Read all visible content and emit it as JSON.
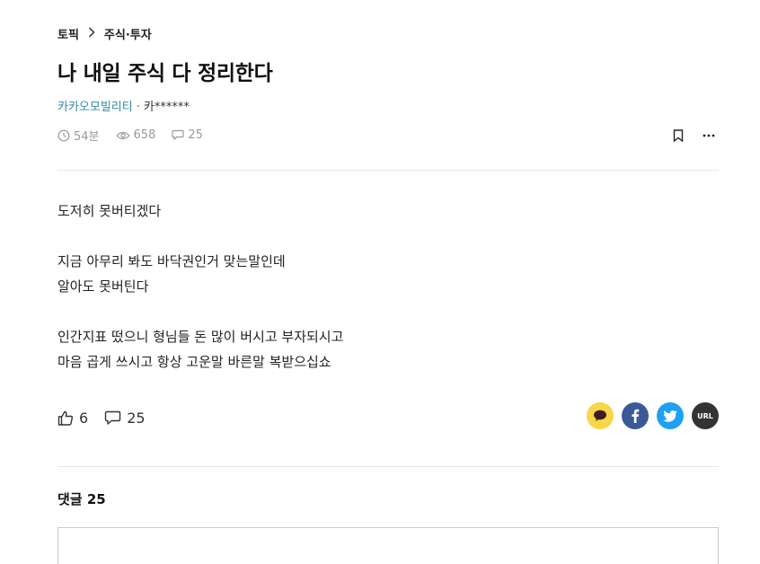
{
  "breadcrumb": {
    "root": "토픽",
    "separator_icon": "chevron-right-icon",
    "category": "주식·투자"
  },
  "post": {
    "title": "나 내일 주식 다 정리한다",
    "company": "카카오모빌리티",
    "separator": "·",
    "nickname": "카******",
    "time": "54분",
    "views": "658",
    "comment_count": "25",
    "body": [
      "도저히 못버티겠다",
      "",
      "지금 아무리 봐도 바닥권인거 맞는말인데",
      "알아도 못버틴다",
      "",
      "인간지표 떴으니 형님들 돈 많이 버시고 부자되시고",
      "마음 곱게 쓰시고 항상 고운말 바른말 복받으십쇼"
    ]
  },
  "reactions": {
    "likes": "6",
    "comments": "25"
  },
  "share": {
    "kakao_color": "#F7D648",
    "facebook_color": "#3B5998",
    "twitter_color": "#1DA1F2",
    "url_color": "#333333",
    "url_label": "URL"
  },
  "comments": {
    "title": "댓글 25"
  }
}
